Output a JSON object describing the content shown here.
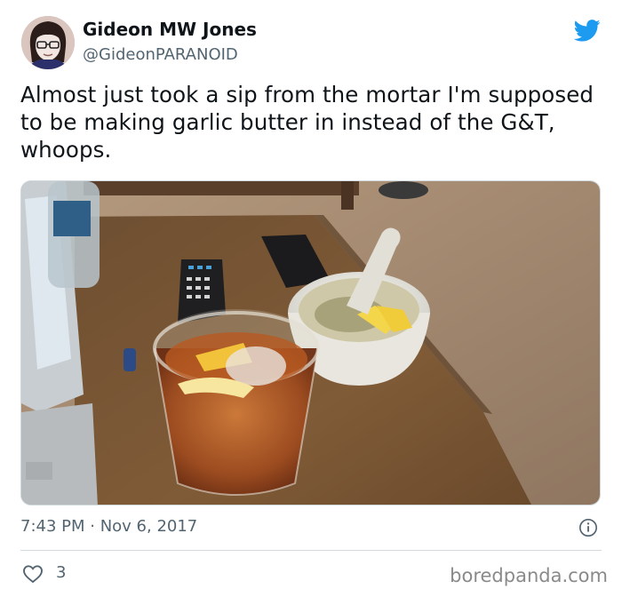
{
  "author": {
    "display_name": "Gideon MW Jones",
    "handle": "@GideonPARANOID",
    "avatar_icon": "avatar-person-glasses"
  },
  "tweet": {
    "text": "Almost just took a sip from the mortar I'm supposed to be making garlic butter in instead of the G&T, whoops.",
    "timestamp": "7:43 PM · Nov 6, 2017",
    "like_count": "3"
  },
  "icons": {
    "brand": "twitter-bird-icon",
    "info": "info-icon",
    "like": "heart-outline-icon"
  },
  "colors": {
    "twitter_blue": "#1d9bf0",
    "secondary_text": "#536471",
    "primary_text": "#0f1419",
    "watermark": "#8a8a8a"
  },
  "watermark": {
    "text": "boredpanda.com"
  }
}
